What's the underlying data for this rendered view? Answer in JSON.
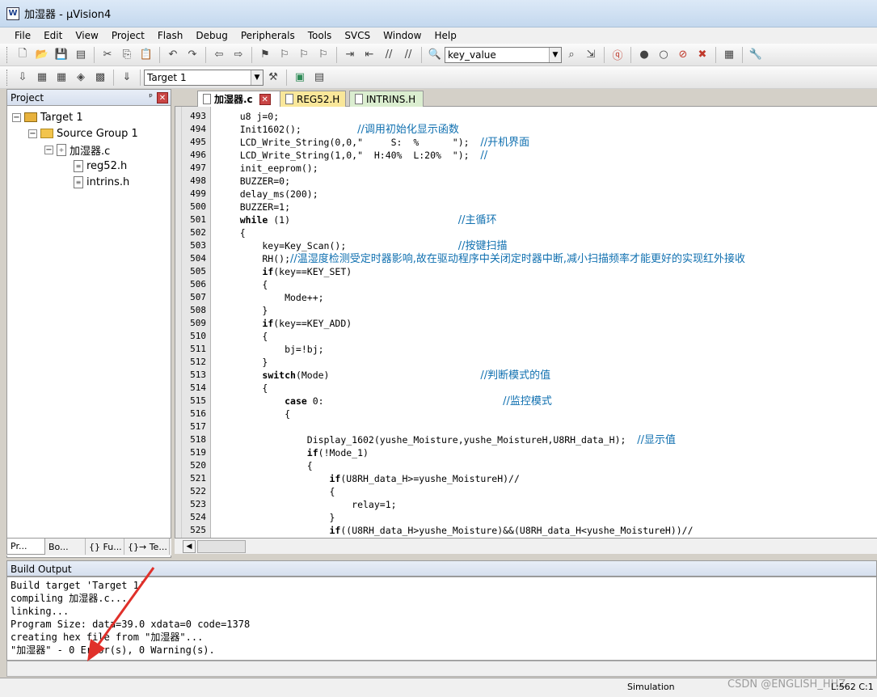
{
  "window": {
    "title": "加湿器  - µVision4",
    "app_icon": "uvision-icon"
  },
  "menu": [
    "File",
    "Edit",
    "View",
    "Project",
    "Flash",
    "Debug",
    "Peripherals",
    "Tools",
    "SVCS",
    "Window",
    "Help"
  ],
  "toolbar": {
    "find_value": "key_value",
    "target_value": "Target 1"
  },
  "project": {
    "header": "Project",
    "tree": {
      "target": "Target 1",
      "group": "Source Group 1",
      "file": "加湿器.c",
      "children": [
        "reg52.h",
        "intrins.h"
      ]
    },
    "tabs": [
      "Pr...",
      "Bo...",
      "{} Fu...",
      "{}→ Te..."
    ]
  },
  "editor": {
    "tabs": [
      {
        "label": "加湿器.c"
      },
      {
        "label": "REG52.H"
      },
      {
        "label": "INTRINS.H"
      }
    ],
    "lines": [
      {
        "no": "493",
        "code": "    u8 j=0;"
      },
      {
        "no": "494",
        "code": "    Init1602();          ",
        "comment": "//调用初始化显示函数"
      },
      {
        "no": "495",
        "code": "    LCD_Write_String(0,0,\"     S:  %      \");  ",
        "comment": "//开机界面"
      },
      {
        "no": "496",
        "code": "    LCD_Write_String(1,0,\"  H:40%  L:20%  \");  ",
        "comment": "//"
      },
      {
        "no": "497",
        "code": "    init_eeprom();"
      },
      {
        "no": "498",
        "code": "    BUZZER=0;"
      },
      {
        "no": "499",
        "code": "    delay_ms(200);"
      },
      {
        "no": "500",
        "code": "    BUZZER=1;"
      },
      {
        "no": "501",
        "code": "    while (1)                              ",
        "comment": "//主循环",
        "kw": "while"
      },
      {
        "no": "502",
        "code": "    {"
      },
      {
        "no": "503",
        "code": "        key=Key_Scan();                    ",
        "comment": "//按键扫描"
      },
      {
        "no": "504",
        "code": "        RH();",
        "comment": "//温湿度检测受定时器影响,故在驱动程序中关闭定时器中断,减小扫描频率才能更好的实现红外接收"
      },
      {
        "no": "505",
        "code": "        if(key==KEY_SET)",
        "kw": "if"
      },
      {
        "no": "506",
        "code": "        {"
      },
      {
        "no": "507",
        "code": "            Mode++;"
      },
      {
        "no": "508",
        "code": "        }"
      },
      {
        "no": "509",
        "code": "        if(key==KEY_ADD)",
        "kw": "if"
      },
      {
        "no": "510",
        "code": "        {"
      },
      {
        "no": "511",
        "code": "            bj=!bj;"
      },
      {
        "no": "512",
        "code": "        }"
      },
      {
        "no": "513",
        "code": "        switch(Mode)                           ",
        "comment": "//判断模式的值",
        "kw": "switch"
      },
      {
        "no": "514",
        "code": "        {"
      },
      {
        "no": "515",
        "code": "            case 0:                                ",
        "comment": "//监控模式",
        "kw": "case"
      },
      {
        "no": "516",
        "code": "            {"
      },
      {
        "no": "517",
        "code": ""
      },
      {
        "no": "518",
        "code": "                Display_1602(yushe_Moisture,yushe_MoistureH,U8RH_data_H);  ",
        "comment": "//显示值"
      },
      {
        "no": "519",
        "code": "                if(!Mode_1)",
        "kw": "if"
      },
      {
        "no": "520",
        "code": "                {"
      },
      {
        "no": "521",
        "code": "                    if(U8RH_data_H>=yushe_MoistureH)//",
        "kw": "if"
      },
      {
        "no": "522",
        "code": "                    {"
      },
      {
        "no": "523",
        "code": "                        relay=1;"
      },
      {
        "no": "524",
        "code": "                    }"
      },
      {
        "no": "525",
        "code": "                    if((U8RH_data_H>yushe_Moisture)&&(U8RH_data_H<yushe_MoistureH))//",
        "kw": "if"
      }
    ]
  },
  "build": {
    "header": "Build Output",
    "lines": [
      "Build target 'Target 1'",
      "compiling 加湿器.c...",
      "linking...",
      "Program Size: data=39.0 xdata=0 code=1378",
      "creating hex file from \"加湿器\"...",
      "\"加湿器\" - 0 Error(s), 0 Warning(s)."
    ]
  },
  "status": {
    "mode": "Simulation",
    "position": "L:562 C:1",
    "watermark": "CSDN @ENGLISH_HHZ"
  },
  "colors": {
    "comment": "#1070b0",
    "annotation_arrow": "#e0302a"
  }
}
